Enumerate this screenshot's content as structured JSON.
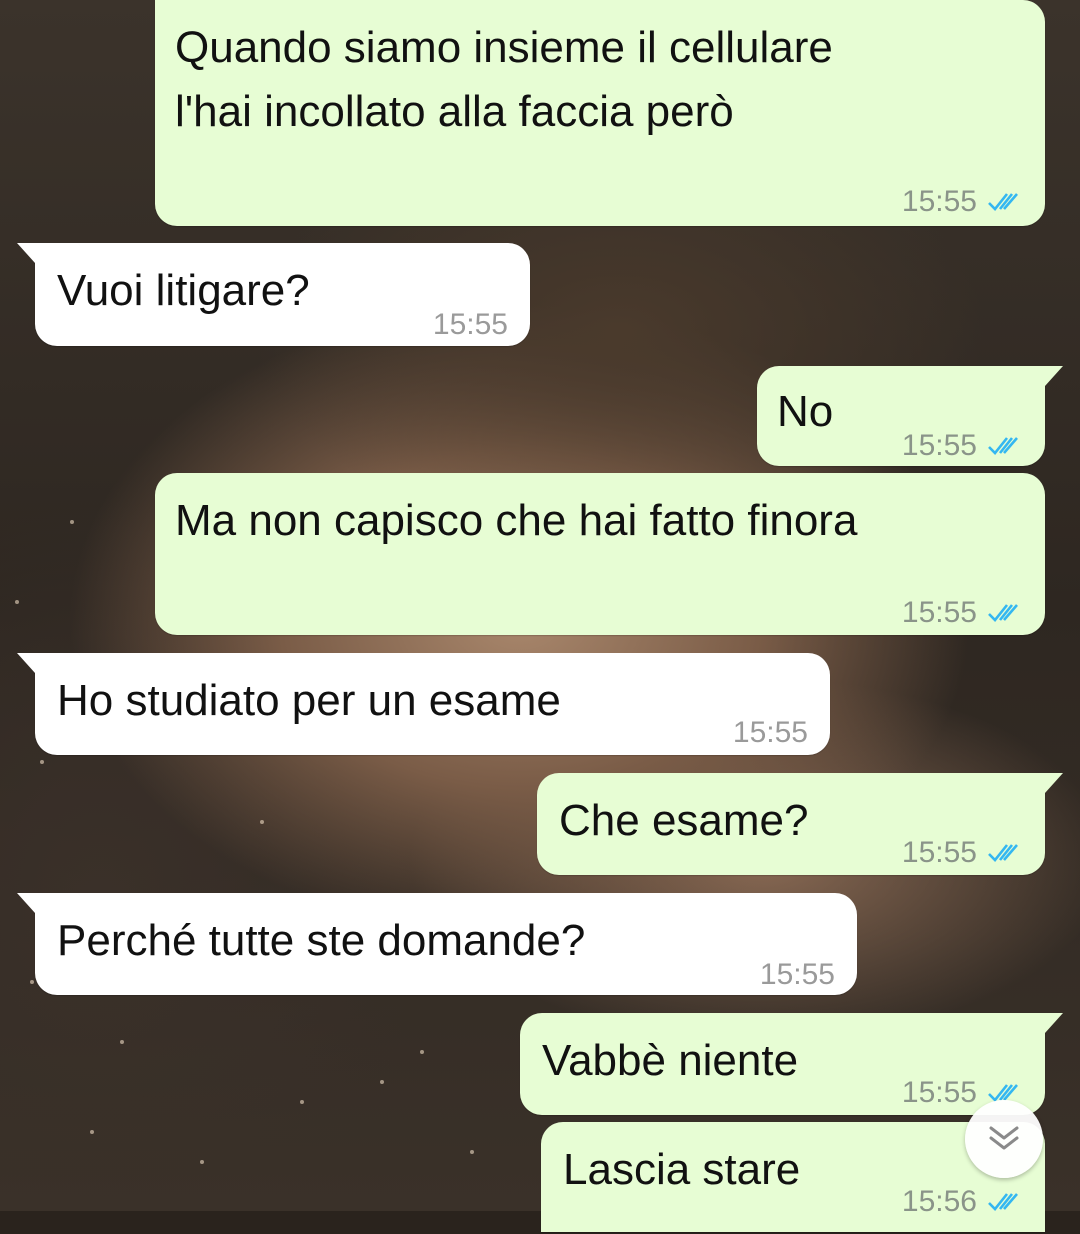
{
  "messages": [
    {
      "dir": "out",
      "lines": [
        "Quando siamo insieme il cellulare",
        "l'hai incollato alla faccia però"
      ],
      "time": "15:55",
      "read": true
    },
    {
      "dir": "in",
      "lines": [
        "Vuoi litigare?"
      ],
      "time": "15:55"
    },
    {
      "dir": "out",
      "lines": [
        "No"
      ],
      "time": "15:55",
      "read": true
    },
    {
      "dir": "out",
      "lines": [
        "Ma non capisco che hai fatto finora"
      ],
      "time": "15:55",
      "read": true
    },
    {
      "dir": "in",
      "lines": [
        "Ho studiato per un esame"
      ],
      "time": "15:55"
    },
    {
      "dir": "out",
      "lines": [
        "Che esame?"
      ],
      "time": "15:55",
      "read": true
    },
    {
      "dir": "in",
      "lines": [
        "Perché tutte ste domande?"
      ],
      "time": "15:55"
    },
    {
      "dir": "out",
      "lines": [
        "Vabbè niente"
      ],
      "time": "15:55",
      "read": true
    },
    {
      "dir": "out",
      "lines": [
        "Lascia stare"
      ],
      "time": "15:56",
      "read": true
    }
  ],
  "icons": {
    "read_receipt": "double-check-icon",
    "scroll_down": "double-chevron-down-icon"
  },
  "colors": {
    "outgoing_bubble": "#e7fdd4",
    "incoming_bubble": "#ffffff",
    "read_tick": "#34b7f1"
  }
}
